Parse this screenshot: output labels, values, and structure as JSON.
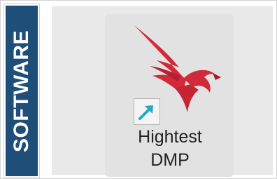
{
  "side_tab": {
    "label": "SOFTWARE",
    "color": "#1f4e79"
  },
  "desktop_icon": {
    "label": "Hightest\nDMP",
    "logo": "falcon-logo",
    "logo_color": "#d12a3a",
    "overlay": "shortcut-arrow-icon",
    "overlay_color": "#25a9c9"
  }
}
